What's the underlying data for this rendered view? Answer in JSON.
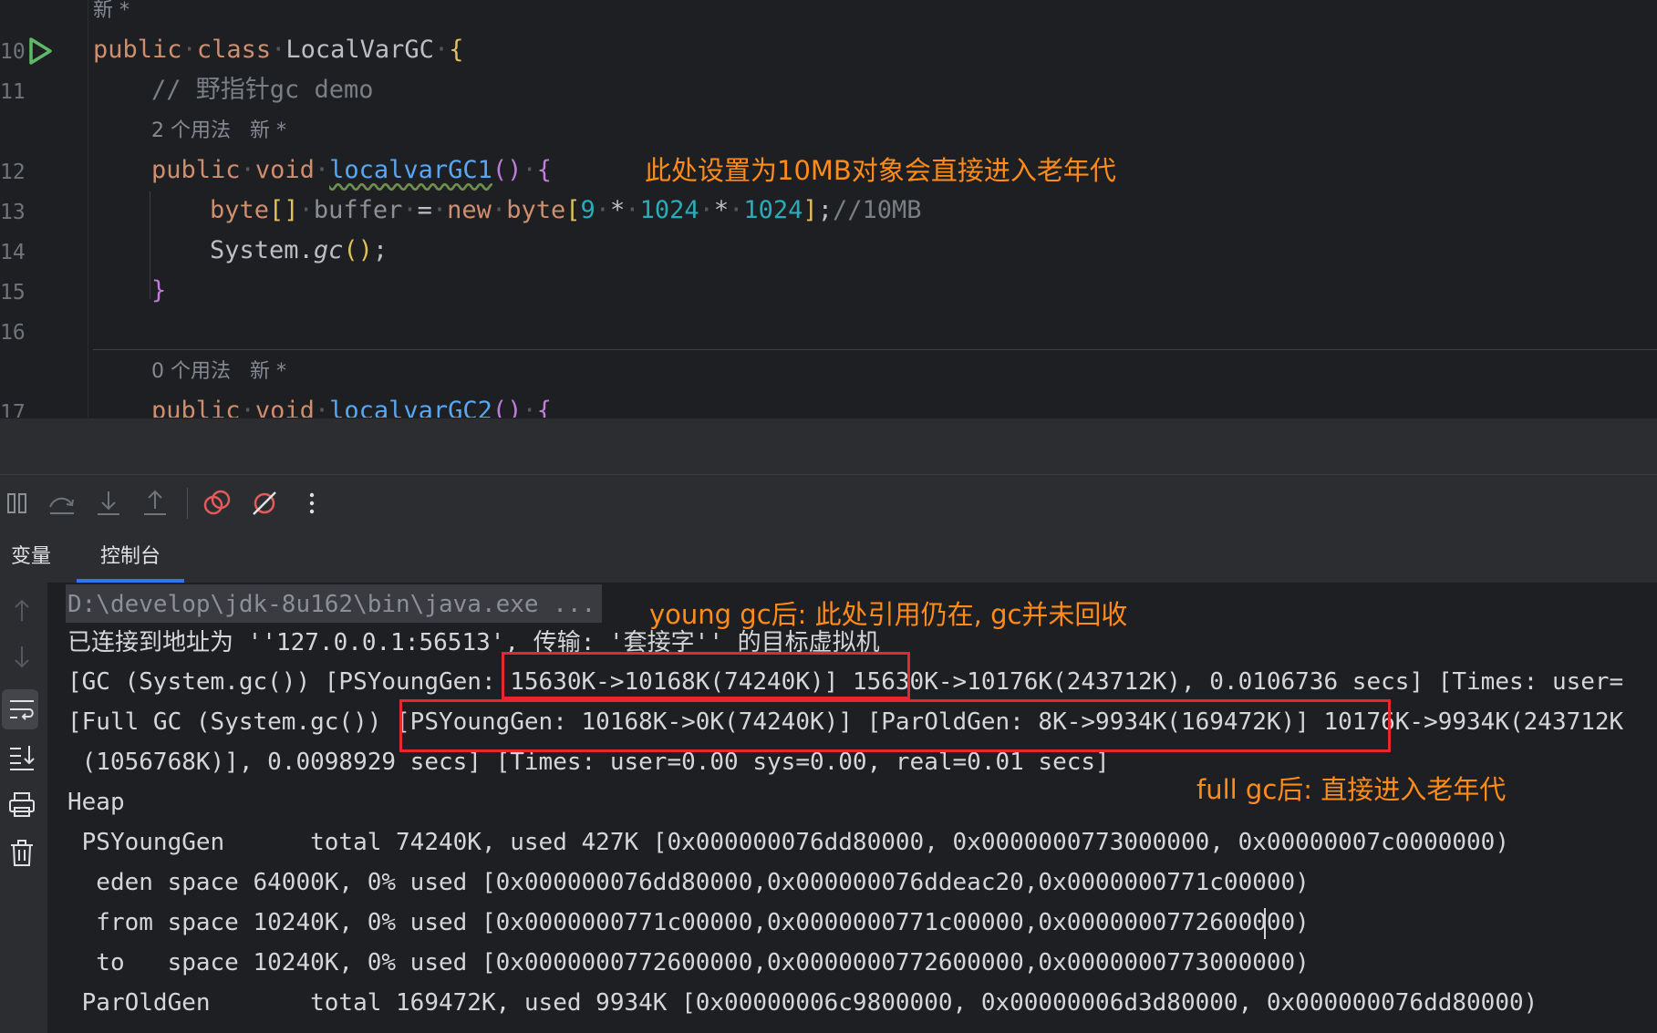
{
  "editor": {
    "line_numbers": [
      "10",
      "11",
      "12",
      "13",
      "14",
      "15",
      "16",
      "17"
    ],
    "hint_new_top": "新 *",
    "class_decl": {
      "kw1": "public",
      "kw2": "class",
      "name": "LocalVarGC",
      "brace": "{"
    },
    "comment": "// 野指针gc demo",
    "usage_hint_1": "2 个用法   新 *",
    "method1": {
      "kw1": "public",
      "kw2": "void",
      "name": "localvarGC1",
      "parens": "()",
      "brace": "{"
    },
    "stmt1": {
      "type": "byte",
      "brackets": "[]",
      "var": "buffer",
      "eq": "=",
      "kw_new": "new",
      "type2": "byte",
      "lb": "[",
      "n1": "9",
      "op1": "*",
      "n2": "1024",
      "op2": "*",
      "n3": "1024",
      "rb": "]",
      "semi": ";",
      "comment": "//10MB"
    },
    "stmt2": {
      "cls": "System",
      "dot": ".",
      "call": "gc",
      "parens": "()",
      "semi": ";"
    },
    "close_brace": "}",
    "usage_hint_2": "0 个用法   新 *",
    "method2": {
      "kw1": "public",
      "kw2": "void",
      "name": "localvarGC2",
      "parens": "()",
      "brace": "{"
    }
  },
  "annotations": {
    "top": "此处设置为10MB对象会直接进入老年代",
    "young": "young gc后: 此处引用仍在, gc并未回收",
    "full": "full gc后: 直接进入老年代"
  },
  "toolbar": {
    "icons": [
      "resume-icon",
      "step-over-icon",
      "step-into-icon",
      "step-out-icon",
      "view-breakpoints-icon",
      "mute-breakpoints-icon",
      "more-icon"
    ]
  },
  "tabs": [
    {
      "label": "变量",
      "active": false
    },
    {
      "label": "控制台",
      "active": true
    }
  ],
  "console": {
    "lines": [
      "D:\\develop\\jdk-8u162\\bin\\java.exe ...",
      "已连接到地址为 ''127.0.0.1:56513', 传输: '套接字'' 的目标虚拟机",
      "[GC (System.gc()) [PSYoungGen: 15630K->10168K(74240K)] 15630K->10176K(243712K), 0.0106736 secs] [Times: user=",
      "[Full GC (System.gc()) [PSYoungGen: 10168K->0K(74240K)] [ParOldGen: 8K->9934K(169472K)] 10176K->9934K(243712K",
      " (1056768K)], 0.0098929 secs] [Times: user=0.00 sys=0.00, real=0.01 secs]",
      "Heap",
      " PSYoungGen      total 74240K, used 427K [0x000000076dd80000, 0x0000000773000000, 0x00000007c0000000)",
      "  eden space 64000K, 0% used [0x000000076dd80000,0x000000076ddeac20,0x0000000771c00000)",
      "  from space 10240K, 0% used [0x0000000771c00000,0x0000000771c00000,0x0000000772600000)",
      "  to   space 10240K, 0% used [0x0000000772600000,0x0000000772600000,0x0000000773000000)",
      " ParOldGen       total 169472K, used 9934K [0x00000006c9800000, 0x00000006d3d80000, 0x000000076dd80000)"
    ]
  },
  "colors": {
    "annotation": "#ff8c1a",
    "highlight_box": "#e8262d",
    "keyword": "#cf8e6d",
    "function": "#56a8f5",
    "number": "#2aacb8",
    "active_tab": "#3574f0",
    "run_icon": "#5fb865"
  }
}
